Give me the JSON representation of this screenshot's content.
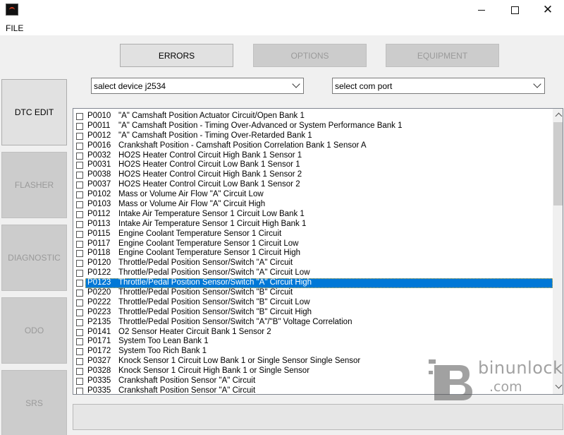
{
  "window": {
    "close_glyph": "✕"
  },
  "menu": {
    "file": "FILE"
  },
  "top_buttons": {
    "errors": "ERRORS",
    "options": "OPTIONS",
    "equipment": "EQUIPMENT"
  },
  "side_buttons": {
    "dtc_edit": "DTC EDIT",
    "flasher": "FLASHER",
    "diagnostic": "DIAGNOSTIC",
    "odo": "ODO",
    "srs": "SRS"
  },
  "combos": {
    "device": "salect device j2534",
    "port": "select com port"
  },
  "dtc_list": [
    {
      "code": "P0010",
      "desc": "\"A\" Camshaft Position Actuator Circuit/Open Bank 1"
    },
    {
      "code": "P0011",
      "desc": "\"A\" Camshaft Position - Timing Over-Advanced or System Performance Bank 1"
    },
    {
      "code": "P0012",
      "desc": "\"A\" Camshaft Position - Timing Over-Retarded Bank 1"
    },
    {
      "code": "P0016",
      "desc": "Crankshaft Position - Camshaft Position Correlation Bank 1 Sensor A"
    },
    {
      "code": "P0032",
      "desc": "HO2S Heater Control Circuit High Bank 1 Sensor 1"
    },
    {
      "code": "P0031",
      "desc": "HO2S Heater Control Circuit Low Bank 1 Sensor 1"
    },
    {
      "code": "P0038",
      "desc": "HO2S Heater Control Circuit High Bank 1 Sensor 2"
    },
    {
      "code": "P0037",
      "desc": "HO2S Heater Control Circuit Low Bank 1 Sensor 2"
    },
    {
      "code": "P0102",
      "desc": "Mass or Volume Air Flow \"A\" Circuit Low"
    },
    {
      "code": "P0103",
      "desc": "Mass or Volume Air Flow \"A\" Circuit High"
    },
    {
      "code": "P0112",
      "desc": "Intake Air Temperature Sensor 1 Circuit Low Bank 1"
    },
    {
      "code": "P0113",
      "desc": "Intake Air Temperature Sensor 1 Circuit High Bank 1"
    },
    {
      "code": "P0115",
      "desc": "Engine Coolant Temperature Sensor 1 Circuit"
    },
    {
      "code": "P0117",
      "desc": "Engine Coolant Temperature Sensor 1 Circuit Low"
    },
    {
      "code": "P0118",
      "desc": "Engine Coolant Temperature Sensor 1 Circuit High"
    },
    {
      "code": "P0120",
      "desc": "Throttle/Pedal Position Sensor/Switch \"A\" Circuit"
    },
    {
      "code": "P0122",
      "desc": "Throttle/Pedal Position Sensor/Switch \"A\" Circuit Low"
    },
    {
      "code": "P0123",
      "desc": "Throttle/Pedal Position Sensor/Switch \"A\" Circuit High",
      "selected": true
    },
    {
      "code": "P0220",
      "desc": "Throttle/Pedal Position Sensor/Switch \"B\" Circuit"
    },
    {
      "code": "P0222",
      "desc": "Throttle/Pedal Position Sensor/Switch \"B\" Circuit Low"
    },
    {
      "code": "P0223",
      "desc": "Throttle/Pedal Position Sensor/Switch \"B\" Circuit High"
    },
    {
      "code": "P2135",
      "desc": "Throttle/Pedal Position Sensor/Switch \"A\"/\"B\" Voltage Correlation"
    },
    {
      "code": "P0141",
      "desc": "O2 Sensor Heater Circuit Bank 1 Sensor 2"
    },
    {
      "code": "P0171",
      "desc": "System Too Lean Bank 1"
    },
    {
      "code": "P0172",
      "desc": "System Too Rich Bank 1"
    },
    {
      "code": "P0327",
      "desc": "Knock Sensor 1 Circuit Low Bank 1 or Single Sensor Single Sensor"
    },
    {
      "code": "P0328",
      "desc": "Knock Sensor 1 Circuit High Bank 1 or Single Sensor"
    },
    {
      "code": "P0335",
      "desc": "Crankshaft Position Sensor \"A\" Circuit"
    },
    {
      "code": "P0335",
      "desc": "Crankshaft Position Sensor \"A\" Circuit"
    }
  ],
  "watermark": {
    "name": "binunlock",
    "domain": ".com"
  }
}
